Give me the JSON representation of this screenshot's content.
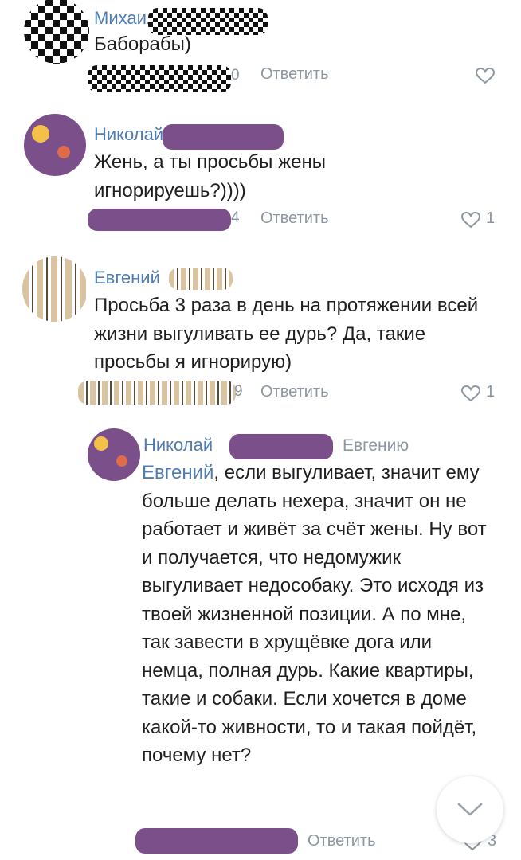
{
  "comments": [
    {
      "name": "Михаил",
      "text": "Баборабы)",
      "time_tail": "0",
      "reply_label": "Ответить",
      "likes": ""
    },
    {
      "name": "Николай",
      "text": "Жень, а ты просьбы жены игнорируешь?))))",
      "time_tail": "4",
      "reply_label": "Ответить",
      "likes": "1"
    },
    {
      "name": "Евгений",
      "text": "Просьба 3 раза в день на протяжении всей жизни выгуливать ее дурь? Да, такие просьбы я игнорирую)",
      "time_tail": "9",
      "reply_label": "Ответить",
      "likes": "1"
    },
    {
      "name": "Николай",
      "reply_to": "Евгению",
      "mention": "Евгений",
      "text": ", если выгуливает, значит ему больше делать нехера, значит он не работает и живёт за счёт жены. Ну вот и получается, что недомужик выгуливает недособаку. Это исходя из твоей жизненной позиции. А по мне, так завести в хрущёвке дога или немца, полная дурь. Какие квартиры, такие и собаки. Если хочется в доме какой-то живности, то и такая пойдёт, почему нет?",
      "reply_label": "Ответить",
      "likes": "3"
    }
  ],
  "icons": {
    "like": "heart-outline-icon",
    "scroll": "chevron-down-icon"
  },
  "colors": {
    "name_link": "#4f7db3",
    "meta_gray": "#8c97a3"
  }
}
